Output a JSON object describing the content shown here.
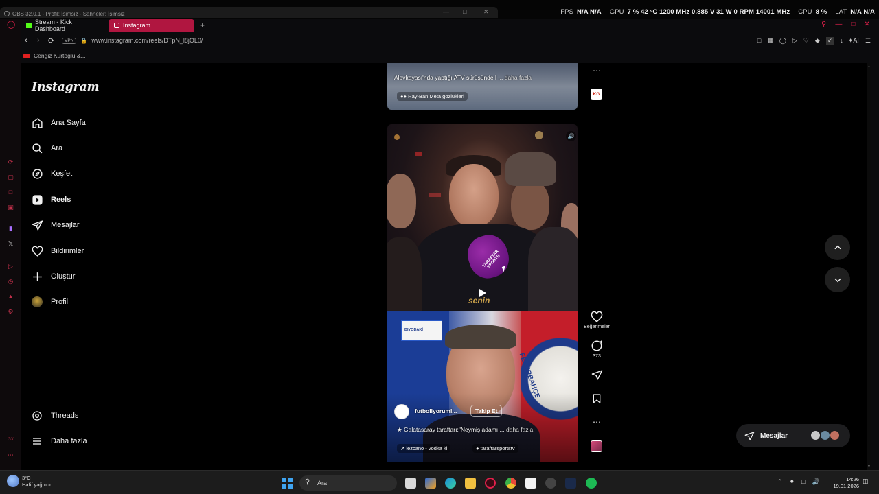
{
  "obs": {
    "window_title": "OBS 32.0.1 - Profil: İsimsiz - Sahneler: İsimsiz",
    "perf": {
      "fps_label": "FPS",
      "fps_values": "N/A  N/A",
      "gpu_label": "GPU",
      "gpu_values": "7 %  42 °C  1200 MHz  0.885 V  31 W  0 RPM  14001 MHz",
      "cpu_label": "CPU",
      "cpu_value": "8 %",
      "lat_label": "LAT",
      "lat_values": "N/A  N/A"
    }
  },
  "browser": {
    "tabs": [
      {
        "label": "Stream - Kick Dashboard"
      },
      {
        "label": "Instagram"
      }
    ],
    "new_tab": "+",
    "vpn_badge": "VPN",
    "url": "www.instagram.com/reels/DTpN_l8jOL0/",
    "ai_label": "AI",
    "bookmarks": [
      {
        "label": "Cengiz Kurtoğlu &..."
      }
    ],
    "accent": "#b01640"
  },
  "instagram": {
    "logo": "Instagram",
    "nav": [
      {
        "label": "Ana Sayfa",
        "icon": "home-icon"
      },
      {
        "label": "Ara",
        "icon": "search-icon"
      },
      {
        "label": "Keşfet",
        "icon": "compass-icon"
      },
      {
        "label": "Reels",
        "icon": "reels-icon"
      },
      {
        "label": "Mesajlar",
        "icon": "send-icon"
      },
      {
        "label": "Bildirimler",
        "icon": "heart-icon"
      },
      {
        "label": "Oluştur",
        "icon": "plus-icon"
      },
      {
        "label": "Profil",
        "icon": "avatar"
      }
    ],
    "nav_bottom": [
      {
        "label": "Threads",
        "icon": "threads-icon"
      },
      {
        "label": "Daha fazla",
        "icon": "menu-icon"
      }
    ],
    "reel_top": {
      "caption": "Alevkayası'nda yaptığı ATV sürüşünde l ...",
      "more": "daha fazla",
      "tag": "Ray-Ban Meta gözlükleri",
      "badge": "KG"
    },
    "reel_mid": {
      "mic_text": "TARAFTAR SPORTS",
      "watermark": "senin"
    },
    "reel_bot": {
      "overlay_box": "BIYODAKİ",
      "username": "futbollyoruml...",
      "follow": "Takip Et",
      "caption": "Galatasaray taraftarı:\"Neymiş adamı ...",
      "more": "daha fazla",
      "music": "lezcano - vodka ki",
      "tagged": "taraftarsportstv",
      "jersey_text": "FENERBAHÇE"
    },
    "actions": {
      "likes_label": "Beğenmeler",
      "comments_count": "373"
    },
    "messages_pill": "Mesajlar"
  },
  "taskbar": {
    "temp": "3°C",
    "weather": "Hafif yağmur",
    "search_placeholder": "Ara",
    "time": "14:26",
    "date": "19.01.2026"
  }
}
